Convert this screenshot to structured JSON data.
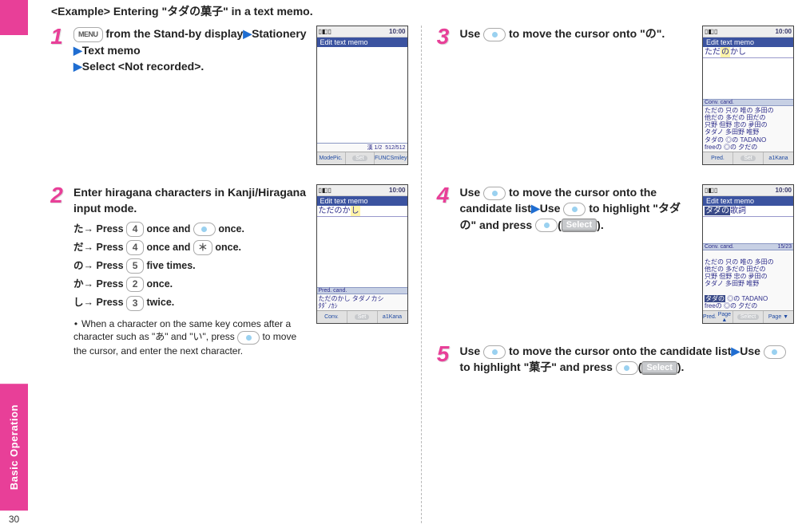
{
  "rail": {
    "tab": "Basic Operation",
    "page": "30"
  },
  "example_title": "<Example> Entering \"タダの菓子\" in a text memo.",
  "steps": {
    "s1": {
      "num": "1",
      "line1_pre": "",
      "line1_key": "MENU",
      "line1_post": " from the Stand-by display",
      "line2": "Stationery",
      "line3": "Text memo",
      "line4": "Select <Not recorded>."
    },
    "s2": {
      "num": "2",
      "title": "Enter hiragana characters in Kanji/Hiragana input mode.",
      "rows": [
        {
          "j": "た→",
          "t1": "Press ",
          "k": "4",
          "t2": " once and ",
          "k2": "oval",
          "t3": " once."
        },
        {
          "j": "だ→",
          "t1": "Press ",
          "k": "4",
          "t2": " once and ",
          "k2": "＊",
          "t3": " once."
        },
        {
          "j": "の→",
          "t1": "Press ",
          "k": "5",
          "t2": " five times.",
          "k2": "",
          "t3": ""
        },
        {
          "j": "か→",
          "t1": "Press ",
          "k": "2",
          "t2": " once.",
          "k2": "",
          "t3": ""
        },
        {
          "j": "し→",
          "t1": "Press ",
          "k": "3",
          "t2": " twice.",
          "k2": "",
          "t3": ""
        }
      ],
      "note_a": "When a character on the same key comes after a character such as \"あ\" and \"い\", press ",
      "note_b": " to move the cursor, and enter the next character."
    },
    "s3": {
      "num": "3",
      "t1": "Use ",
      "t2": " to move the cursor onto \"の\"."
    },
    "s4": {
      "num": "4",
      "t1": "Use ",
      "t2": " to move the cursor onto the candidate list",
      "t3": "Use ",
      "t4": " to highlight \"タダの\" and press ",
      "t5": "(",
      "sel": "Select",
      "t6": ")."
    },
    "s5": {
      "num": "5",
      "t1": "Use ",
      "t2": " to move the cursor onto the candidate list",
      "t3": "Use ",
      "t4": " to highlight \"菓子\" and press ",
      "t5": "(",
      "sel": "Select",
      "t6": ")."
    }
  },
  "phone": {
    "time": "10:00",
    "title": "Edit text memo",
    "p1": {
      "counter": "512/512",
      "foot": [
        "Mode",
        "Set",
        "FUNC",
        "Pic.",
        "",
        "Smiley"
      ],
      "input_mark": "漢 1/2"
    },
    "p2": {
      "input": "ただのか",
      "input_hl": "し",
      "pred_title": "Pred. cand.",
      "pred": "ただのかし タダノカシ\nﾀﾀﾞﾉｶｼ",
      "foot": [
        "Conv.",
        "Set",
        "a1Kana"
      ]
    },
    "p3": {
      "input_pre": "ただ",
      "input_hl": "の",
      "input_post": "かし",
      "conv_title": "Conv. cand.",
      "conv": "ただの 只の 唯の 多田の\n他だの 多だの 田だの\n只野 但野 忠の 夛田の\nタダノ 多田野 唯野\nタダの ◎の TADANO\nfreeの ◎の 夕だの",
      "foot": [
        "Pred.",
        "Set",
        "a1Kana"
      ]
    },
    "p4": {
      "input_hl": "タダの",
      "input_post": "歌詞",
      "conv_title": "Conv. cand.",
      "conv_count": "15/23",
      "conv_pre": "ただの 只の 唯の 多田の\n他だの 多だの 田だの\n只野 但野 忠の 夛田の\nタダノ 多田野 唯野",
      "conv_hl": "タダの",
      "conv_post": " ◎の TADANO\nfreeの ◎の 夕だの",
      "foot": [
        "Pred.",
        "Select",
        ""
      ],
      "foot2": [
        "Page ▲",
        "",
        "Page ▼"
      ]
    }
  }
}
